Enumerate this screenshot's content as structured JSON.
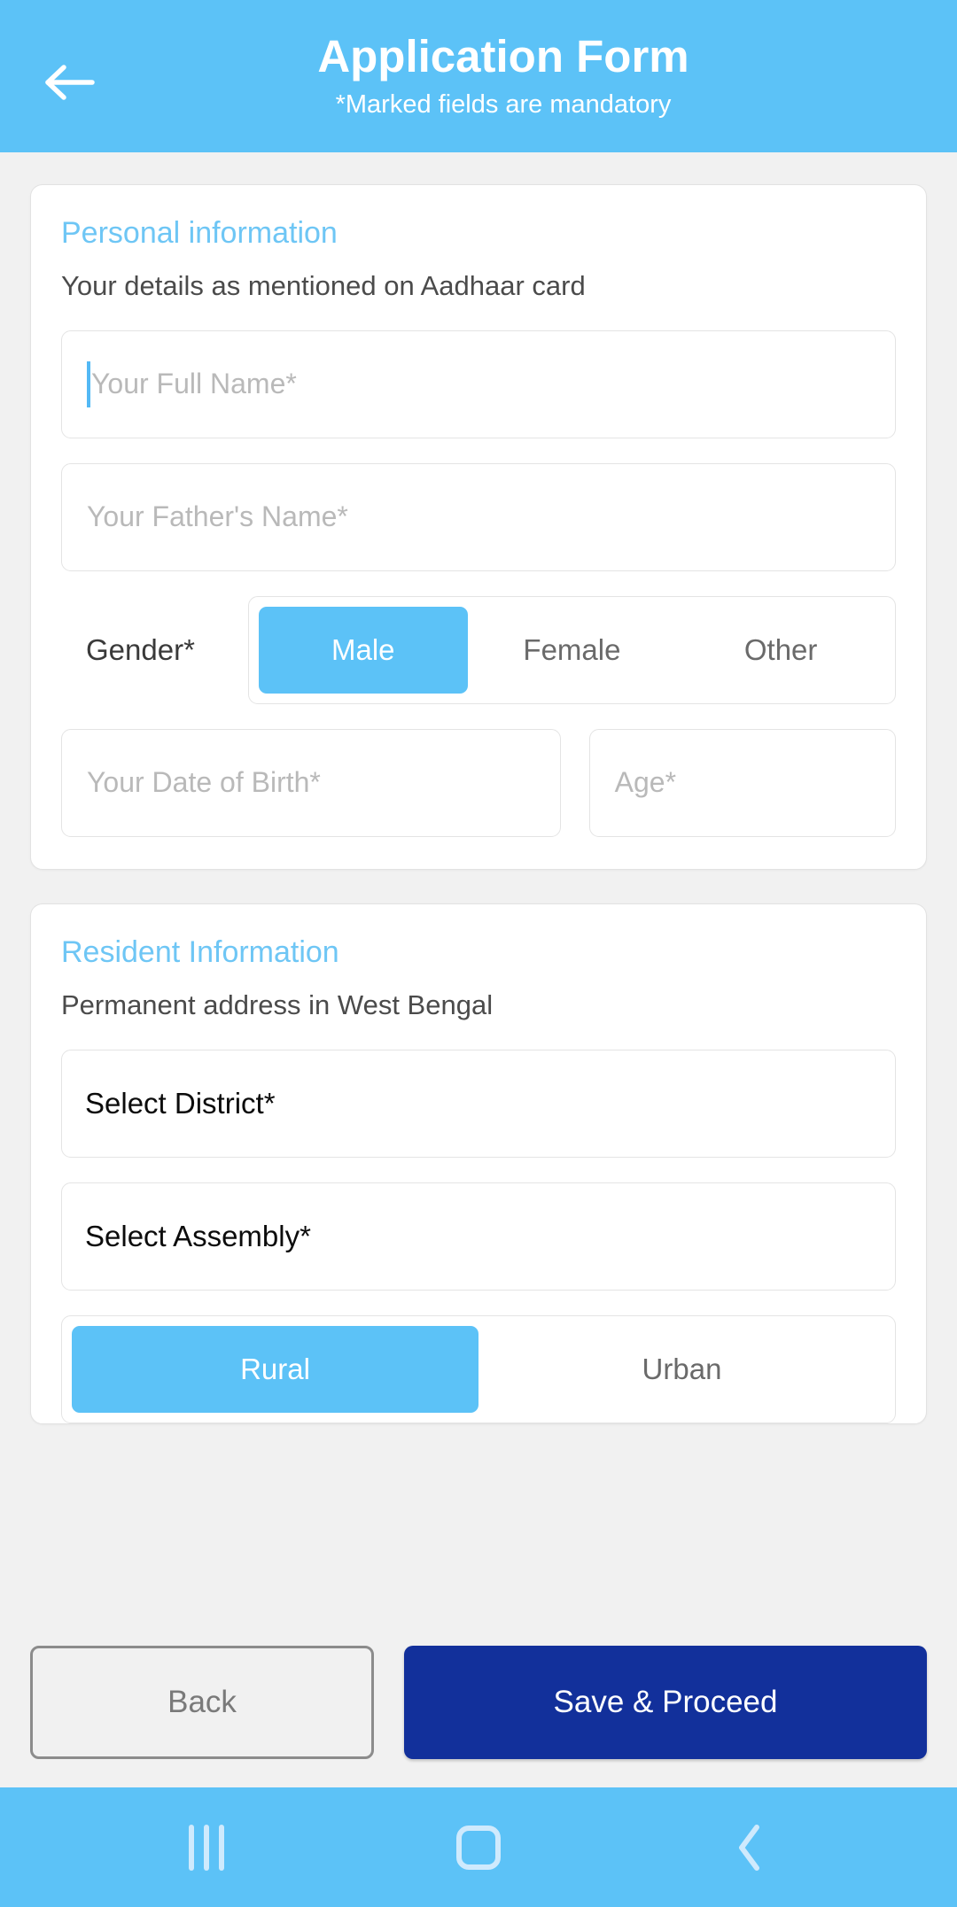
{
  "header": {
    "back_icon": "arrow-left-icon",
    "title": "Application Form",
    "subtitle": "*Marked fields are mandatory",
    "bg_color": "#5CC2F7",
    "text_color": "#FFFFFF"
  },
  "personal": {
    "section_title": "Personal information",
    "section_subtitle": "Your details as mentioned on Aadhaar card",
    "full_name": {
      "value": "",
      "placeholder": "Your Full Name*",
      "focused": true
    },
    "father_name": {
      "value": "",
      "placeholder": "Your Father's Name*",
      "focused": false
    },
    "gender": {
      "label": "Gender*",
      "options": [
        "Male",
        "Female",
        "Other"
      ],
      "selected": "Male"
    },
    "dob": {
      "value": "",
      "placeholder": "Your Date of Birth*"
    },
    "age": {
      "value": "",
      "placeholder": "Age*"
    }
  },
  "resident": {
    "section_title": "Resident Information",
    "section_subtitle": "Permanent address in West Bengal",
    "district": {
      "value": "Select District*"
    },
    "assembly": {
      "value": "Select Assembly*"
    },
    "area_type": {
      "options": [
        "Rural",
        "Urban"
      ],
      "selected": "Rural"
    }
  },
  "actions": {
    "back_label": "Back",
    "save_label": "Save & Proceed",
    "save_color": "#12309B"
  },
  "navbar": {
    "recents_icon": "recents-icon",
    "home_icon": "home-icon",
    "back_icon": "nav-back-icon",
    "bg_color": "#5CC2F7"
  },
  "theme": {
    "accent": "#5CC2F7",
    "section_heading": "#6EC6F5",
    "page_bg": "#F1F1F1"
  }
}
